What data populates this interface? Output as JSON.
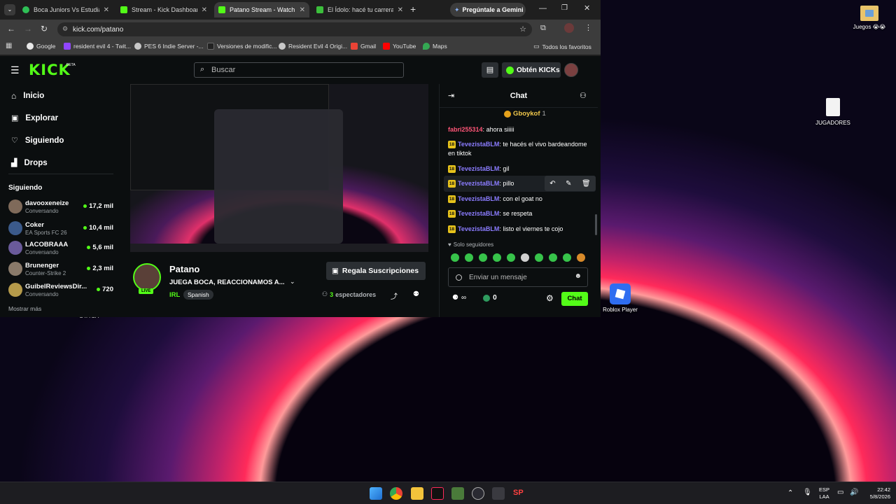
{
  "browser": {
    "tabs": [
      {
        "title": "Boca Juniors Vs Estudiante",
        "color": "#2fbf56",
        "active": false
      },
      {
        "title": "Stream - Kick Dashboard",
        "color": "#53fc18",
        "active": false
      },
      {
        "title": "Patano Stream - Watch Li",
        "color": "#53fc18",
        "active": true
      },
      {
        "title": "El Ídolo: hacé tu carrera e",
        "color": "#3cbf3c",
        "active": false
      }
    ],
    "gemini_button": "Pregúntale a Gemini",
    "url": "kick.com/patano",
    "bookmarks": [
      "Google",
      "resident evil 4 - Twit...",
      "PES 6 Indie Server -...",
      "Versiones de modific...",
      "Resident Evil 4 Origi...",
      "Gmail",
      "YouTube",
      "Maps"
    ],
    "all_bookmarks": "Todos los favoritos"
  },
  "kick": {
    "logo": "KICK",
    "beta": "BETA",
    "search_placeholder": "Buscar",
    "get_kicks": "Obtén KICKs",
    "nav": [
      "Inicio",
      "Explorar",
      "Siguiendo",
      "Drops"
    ],
    "following_title": "Siguiendo",
    "following": [
      {
        "name": "davooxeneize",
        "sub": "Conversando",
        "viewers": "17,2 mil",
        "color": "#7f6a5a"
      },
      {
        "name": "Coker",
        "sub": "EA Sports FC 26",
        "viewers": "10,4 mil",
        "color": "#3b5a8a"
      },
      {
        "name": "LACOBRAAA",
        "sub": "Conversando",
        "viewers": "5,6 mil",
        "color": "#6a5a9a"
      },
      {
        "name": "Brunenger",
        "sub": "Counter-Strike 2",
        "viewers": "2,3 mil",
        "color": "#8a7a6a"
      },
      {
        "name": "GuibelReviewsDir...",
        "sub": "Conversando",
        "viewers": "720",
        "color": "#b59a4a"
      }
    ],
    "show_more": "Mostrar más",
    "stream": {
      "streamer": "Patano",
      "title": "JUEGA BOCA, REACCIONAMOS A...",
      "live": "LIVE",
      "category": "IRL",
      "language": "Spanish",
      "gift_subs": "Regala Suscripciones",
      "viewers_count": "3",
      "viewers_label": "espectadores"
    },
    "chat": {
      "title": "Chat",
      "pinned_user": "Gboykof",
      "pinned_count": "1",
      "messages": [
        {
          "user": "fabri255314",
          "text": "ahora siiiii",
          "color": "#ff5577",
          "badge": ""
        },
        {
          "user": "TevezistaBLM",
          "text": "te hacés el vivo bardeandome en tiktok",
          "color": "#8b7cff",
          "badge": "18"
        },
        {
          "user": "TevezistaBLM",
          "text": "gil",
          "color": "#8b7cff",
          "badge": "18"
        },
        {
          "user": "TevezistaBLM",
          "text": "pillo",
          "color": "#8b7cff",
          "badge": "18"
        },
        {
          "user": "TevezistaBLM",
          "text": "con el goat no",
          "color": "#8b7cff",
          "badge": "18"
        },
        {
          "user": "TevezistaBLM",
          "text": "se respeta",
          "color": "#8b7cff",
          "badge": "18"
        },
        {
          "user": "TevezistaBLM",
          "text": "listo el viernes te cojo",
          "color": "#8b7cff",
          "badge": "18"
        }
      ],
      "followers_only": "Solo seguidores",
      "input_placeholder": "Enviar un mensaje",
      "kicks_count": "0",
      "send_label": "Chat"
    }
  },
  "desktop": {
    "icons": [
      "Juegos 😭😭",
      "JUGADORES",
      "Roblox Player",
      "GTA SA"
    ]
  },
  "taskbar": {
    "lang1": "ESP",
    "lang2": "LAA",
    "time": "22:42",
    "date": "5/8/2026"
  },
  "colors": {
    "kick_green": "#53fc18",
    "bg_dark": "#0b0e0f"
  }
}
